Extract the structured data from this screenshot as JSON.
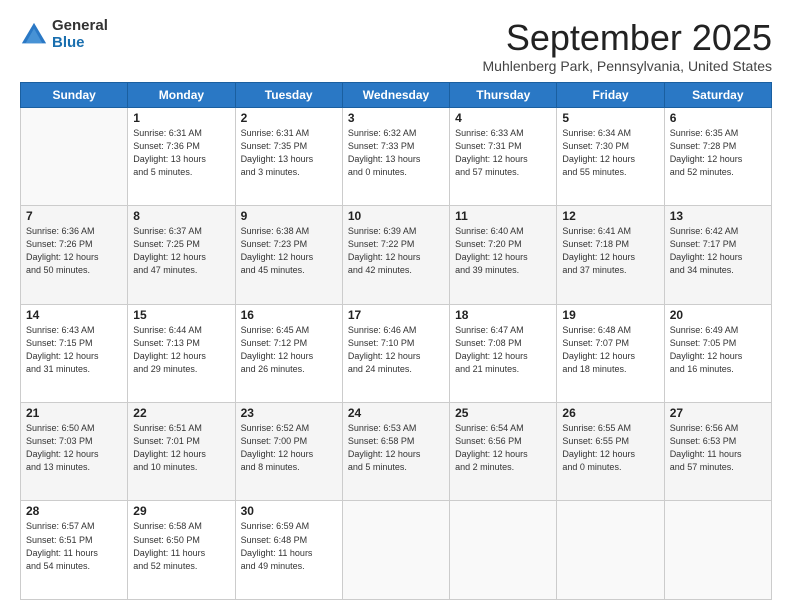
{
  "header": {
    "logo_general": "General",
    "logo_blue": "Blue",
    "month": "September 2025",
    "location": "Muhlenberg Park, Pennsylvania, United States"
  },
  "weekdays": [
    "Sunday",
    "Monday",
    "Tuesday",
    "Wednesday",
    "Thursday",
    "Friday",
    "Saturday"
  ],
  "weeks": [
    [
      {
        "day": "",
        "info": ""
      },
      {
        "day": "1",
        "info": "Sunrise: 6:31 AM\nSunset: 7:36 PM\nDaylight: 13 hours\nand 5 minutes."
      },
      {
        "day": "2",
        "info": "Sunrise: 6:31 AM\nSunset: 7:35 PM\nDaylight: 13 hours\nand 3 minutes."
      },
      {
        "day": "3",
        "info": "Sunrise: 6:32 AM\nSunset: 7:33 PM\nDaylight: 13 hours\nand 0 minutes."
      },
      {
        "day": "4",
        "info": "Sunrise: 6:33 AM\nSunset: 7:31 PM\nDaylight: 12 hours\nand 57 minutes."
      },
      {
        "day": "5",
        "info": "Sunrise: 6:34 AM\nSunset: 7:30 PM\nDaylight: 12 hours\nand 55 minutes."
      },
      {
        "day": "6",
        "info": "Sunrise: 6:35 AM\nSunset: 7:28 PM\nDaylight: 12 hours\nand 52 minutes."
      }
    ],
    [
      {
        "day": "7",
        "info": "Sunrise: 6:36 AM\nSunset: 7:26 PM\nDaylight: 12 hours\nand 50 minutes."
      },
      {
        "day": "8",
        "info": "Sunrise: 6:37 AM\nSunset: 7:25 PM\nDaylight: 12 hours\nand 47 minutes."
      },
      {
        "day": "9",
        "info": "Sunrise: 6:38 AM\nSunset: 7:23 PM\nDaylight: 12 hours\nand 45 minutes."
      },
      {
        "day": "10",
        "info": "Sunrise: 6:39 AM\nSunset: 7:22 PM\nDaylight: 12 hours\nand 42 minutes."
      },
      {
        "day": "11",
        "info": "Sunrise: 6:40 AM\nSunset: 7:20 PM\nDaylight: 12 hours\nand 39 minutes."
      },
      {
        "day": "12",
        "info": "Sunrise: 6:41 AM\nSunset: 7:18 PM\nDaylight: 12 hours\nand 37 minutes."
      },
      {
        "day": "13",
        "info": "Sunrise: 6:42 AM\nSunset: 7:17 PM\nDaylight: 12 hours\nand 34 minutes."
      }
    ],
    [
      {
        "day": "14",
        "info": "Sunrise: 6:43 AM\nSunset: 7:15 PM\nDaylight: 12 hours\nand 31 minutes."
      },
      {
        "day": "15",
        "info": "Sunrise: 6:44 AM\nSunset: 7:13 PM\nDaylight: 12 hours\nand 29 minutes."
      },
      {
        "day": "16",
        "info": "Sunrise: 6:45 AM\nSunset: 7:12 PM\nDaylight: 12 hours\nand 26 minutes."
      },
      {
        "day": "17",
        "info": "Sunrise: 6:46 AM\nSunset: 7:10 PM\nDaylight: 12 hours\nand 24 minutes."
      },
      {
        "day": "18",
        "info": "Sunrise: 6:47 AM\nSunset: 7:08 PM\nDaylight: 12 hours\nand 21 minutes."
      },
      {
        "day": "19",
        "info": "Sunrise: 6:48 AM\nSunset: 7:07 PM\nDaylight: 12 hours\nand 18 minutes."
      },
      {
        "day": "20",
        "info": "Sunrise: 6:49 AM\nSunset: 7:05 PM\nDaylight: 12 hours\nand 16 minutes."
      }
    ],
    [
      {
        "day": "21",
        "info": "Sunrise: 6:50 AM\nSunset: 7:03 PM\nDaylight: 12 hours\nand 13 minutes."
      },
      {
        "day": "22",
        "info": "Sunrise: 6:51 AM\nSunset: 7:01 PM\nDaylight: 12 hours\nand 10 minutes."
      },
      {
        "day": "23",
        "info": "Sunrise: 6:52 AM\nSunset: 7:00 PM\nDaylight: 12 hours\nand 8 minutes."
      },
      {
        "day": "24",
        "info": "Sunrise: 6:53 AM\nSunset: 6:58 PM\nDaylight: 12 hours\nand 5 minutes."
      },
      {
        "day": "25",
        "info": "Sunrise: 6:54 AM\nSunset: 6:56 PM\nDaylight: 12 hours\nand 2 minutes."
      },
      {
        "day": "26",
        "info": "Sunrise: 6:55 AM\nSunset: 6:55 PM\nDaylight: 12 hours\nand 0 minutes."
      },
      {
        "day": "27",
        "info": "Sunrise: 6:56 AM\nSunset: 6:53 PM\nDaylight: 11 hours\nand 57 minutes."
      }
    ],
    [
      {
        "day": "28",
        "info": "Sunrise: 6:57 AM\nSunset: 6:51 PM\nDaylight: 11 hours\nand 54 minutes."
      },
      {
        "day": "29",
        "info": "Sunrise: 6:58 AM\nSunset: 6:50 PM\nDaylight: 11 hours\nand 52 minutes."
      },
      {
        "day": "30",
        "info": "Sunrise: 6:59 AM\nSunset: 6:48 PM\nDaylight: 11 hours\nand 49 minutes."
      },
      {
        "day": "",
        "info": ""
      },
      {
        "day": "",
        "info": ""
      },
      {
        "day": "",
        "info": ""
      },
      {
        "day": "",
        "info": ""
      }
    ]
  ]
}
